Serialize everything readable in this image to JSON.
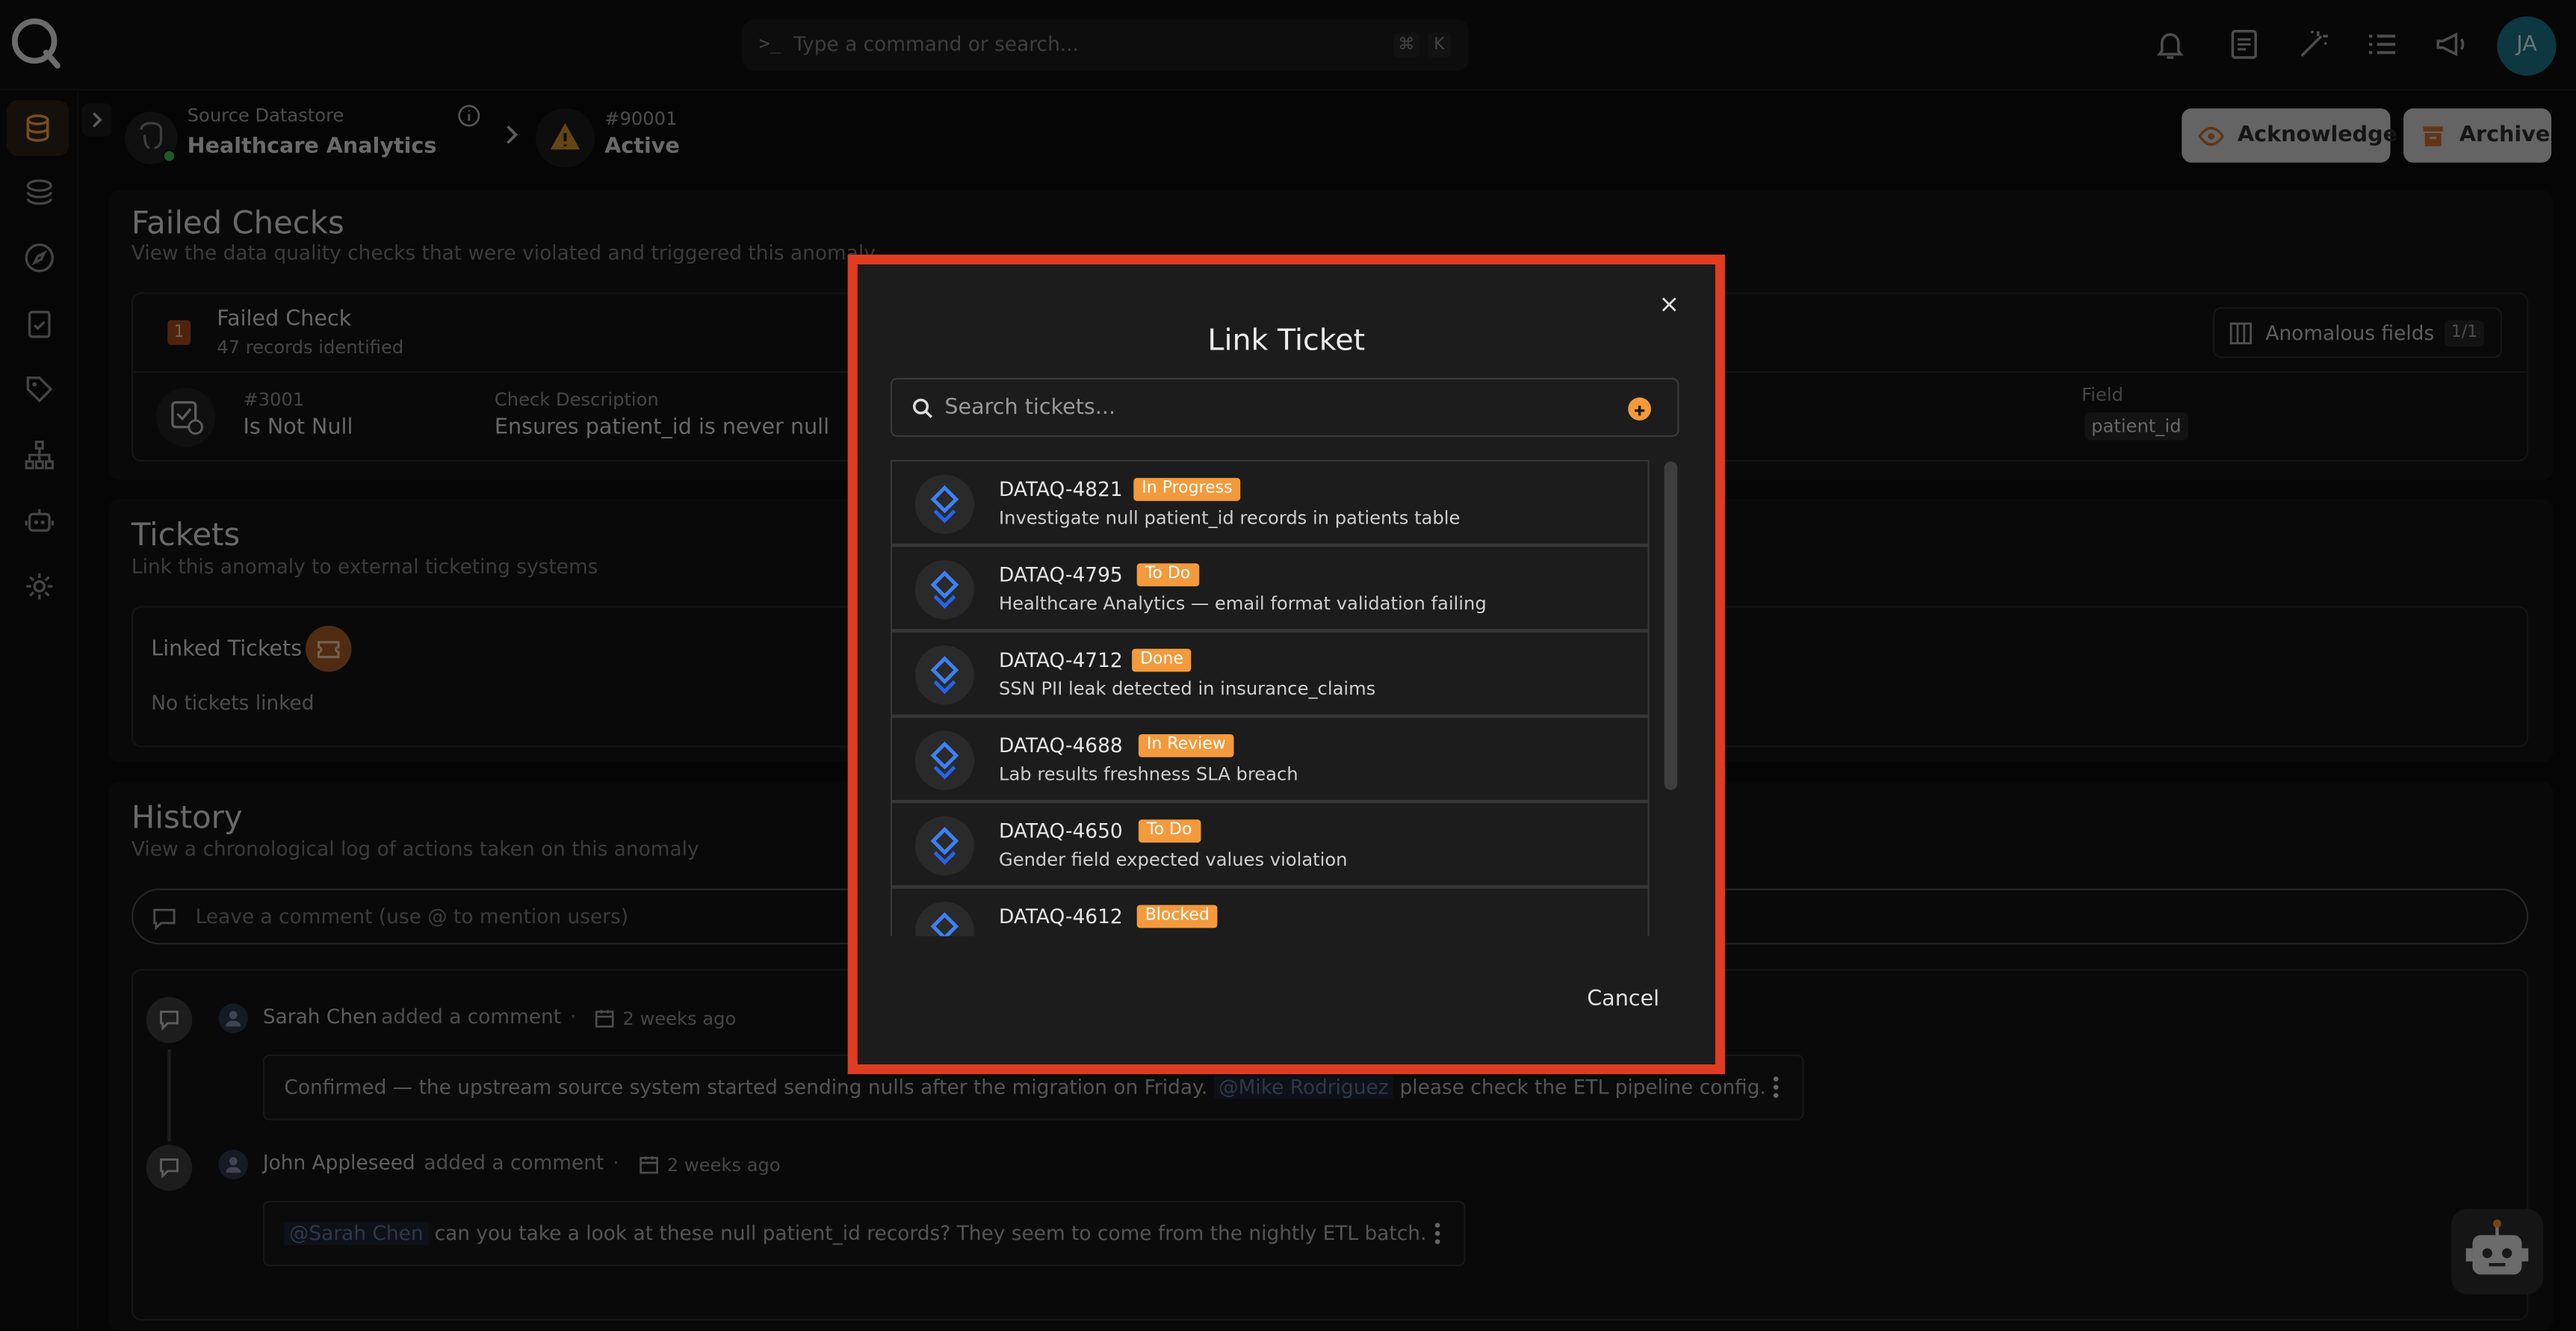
{
  "command_bar": {
    "prompt": ">_",
    "placeholder": "Type a command or search...",
    "shortcut_keys": [
      "⌘",
      "K"
    ]
  },
  "user": {
    "initials": "JA"
  },
  "breadcrumb": {
    "datastore_label": "Source Datastore",
    "datastore_name": "Healthcare Analytics",
    "anomaly_id": "#90001",
    "anomaly_status": "Active"
  },
  "actions": {
    "acknowledge": "Acknowledge",
    "archive": "Archive"
  },
  "failed_checks": {
    "title": "Failed Checks",
    "subtitle": "View the data quality checks that were violated and triggered this anomaly",
    "count": "1",
    "label": "Failed Check",
    "records": "47 records identified",
    "anomalous_fields_label": "Anomalous fields",
    "anomalous_fields_count": "1/1",
    "check": {
      "id": "#3001",
      "rule": "Is Not Null",
      "description_label": "Check Description",
      "description": "Ensures patient_id is never null",
      "field_label": "Field",
      "field": "patient_id"
    }
  },
  "tickets": {
    "title": "Tickets",
    "subtitle": "Link this anomaly to external ticketing systems",
    "linked_label": "Linked Tickets",
    "empty": "No tickets linked"
  },
  "history": {
    "title": "History",
    "subtitle": "View a chronological log of actions taken on this anomaly",
    "comment_placeholder": "Leave a comment (use @ to mention users)",
    "entries": [
      {
        "author": "Sarah Chen",
        "action": "added a comment",
        "sep": "·",
        "time": "2 weeks ago",
        "text_before": "Confirmed — the upstream source system started sending nulls after the migration on Friday.",
        "mention": "@Mike Rodriguez",
        "text_after": "please check the ETL pipeline config."
      },
      {
        "author": "John Appleseed",
        "action": "added a comment",
        "sep": "·",
        "time": "2 weeks ago",
        "text_before": "",
        "mention": "@Sarah Chen",
        "text_after": "can you take a look at these null patient_id records? They seem to come from the nightly ETL batch."
      }
    ]
  },
  "modal": {
    "title": "Link Ticket",
    "close": "×",
    "search_placeholder": "Search tickets...",
    "cancel": "Cancel",
    "tickets": [
      {
        "key": "DATAQ-4821",
        "status": "In Progress",
        "summary": "Investigate null patient_id records in patients table"
      },
      {
        "key": "DATAQ-4795",
        "status": "To Do",
        "summary": "Healthcare Analytics — email format validation failing"
      },
      {
        "key": "DATAQ-4712",
        "status": "Done",
        "summary": "SSN PII leak detected in insurance_claims"
      },
      {
        "key": "DATAQ-4688",
        "status": "In Review",
        "summary": "Lab results freshness SLA breach"
      },
      {
        "key": "DATAQ-4650",
        "status": "To Do",
        "summary": "Gender field expected values violation"
      },
      {
        "key": "DATAQ-4612",
        "status": "Blocked",
        "summary": ""
      }
    ]
  },
  "colors": {
    "accent": "#f39a3c",
    "highlight_border": "#e03c22",
    "status_online": "#3bb54a",
    "avatar_bg": "#1a6f83"
  },
  "icons": {
    "sidebar": [
      "database-icon",
      "layers-icon",
      "compass-icon",
      "clipboard-check-icon",
      "tag-icon",
      "hierarchy-icon",
      "robot-icon",
      "gear-icon"
    ],
    "topbar": [
      "bell-icon",
      "document-icon",
      "magic-wand-icon",
      "list-icon",
      "megaphone-icon"
    ]
  }
}
